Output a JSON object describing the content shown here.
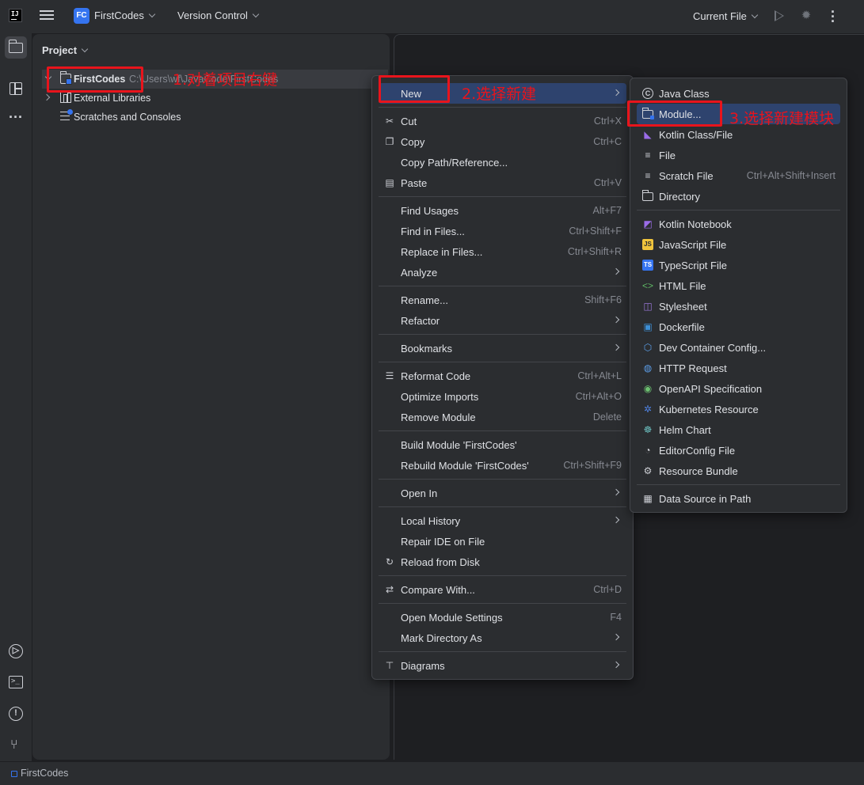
{
  "titlebar": {
    "project_badge": "FC",
    "project_name": "FirstCodes",
    "vcs_label": "Version Control",
    "run_config": "Current File"
  },
  "project_panel": {
    "title": "Project",
    "tree": [
      {
        "label": "FirstCodes",
        "path": "C:\\Users\\wf\\JavaCode\\FirstCodes",
        "icon": "module-folder-icon",
        "expanded": true
      },
      {
        "label": "External Libraries",
        "icon": "libraries-icon",
        "expanded": false
      },
      {
        "label": "Scratches and Consoles",
        "icon": "scratches-icon"
      }
    ]
  },
  "context_menu": {
    "items": [
      {
        "label": "New",
        "submenu": true,
        "highlighted": true
      },
      {
        "separator": true
      },
      {
        "label": "Cut",
        "shortcut": "Ctrl+X",
        "icon": "cut-icon"
      },
      {
        "label": "Copy",
        "shortcut": "Ctrl+C",
        "icon": "copy-icon"
      },
      {
        "label": "Copy Path/Reference..."
      },
      {
        "label": "Paste",
        "shortcut": "Ctrl+V",
        "icon": "paste-icon"
      },
      {
        "separator": true
      },
      {
        "label": "Find Usages",
        "shortcut": "Alt+F7"
      },
      {
        "label": "Find in Files...",
        "shortcut": "Ctrl+Shift+F"
      },
      {
        "label": "Replace in Files...",
        "shortcut": "Ctrl+Shift+R"
      },
      {
        "label": "Analyze",
        "submenu": true
      },
      {
        "separator": true
      },
      {
        "label": "Rename...",
        "shortcut": "Shift+F6"
      },
      {
        "label": "Refactor",
        "submenu": true
      },
      {
        "separator": true
      },
      {
        "label": "Bookmarks",
        "submenu": true
      },
      {
        "separator": true
      },
      {
        "label": "Reformat Code",
        "shortcut": "Ctrl+Alt+L",
        "icon": "reformat-icon"
      },
      {
        "label": "Optimize Imports",
        "shortcut": "Ctrl+Alt+O"
      },
      {
        "label": "Remove Module",
        "shortcut": "Delete"
      },
      {
        "separator": true
      },
      {
        "label": "Build Module 'FirstCodes'"
      },
      {
        "label": "Rebuild Module 'FirstCodes'",
        "shortcut": "Ctrl+Shift+F9"
      },
      {
        "separator": true
      },
      {
        "label": "Open In",
        "submenu": true
      },
      {
        "separator": true
      },
      {
        "label": "Local History",
        "submenu": true
      },
      {
        "label": "Repair IDE on File"
      },
      {
        "label": "Reload from Disk",
        "icon": "reload-icon"
      },
      {
        "separator": true
      },
      {
        "label": "Compare With...",
        "shortcut": "Ctrl+D",
        "icon": "compare-icon"
      },
      {
        "separator": true
      },
      {
        "label": "Open Module Settings",
        "shortcut": "F4"
      },
      {
        "label": "Mark Directory As",
        "submenu": true
      },
      {
        "separator": true
      },
      {
        "label": "Diagrams",
        "submenu": true,
        "icon": "diagrams-icon"
      }
    ]
  },
  "new_submenu": {
    "items": [
      {
        "label": "Java Class",
        "icon": "java-class-icon"
      },
      {
        "label": "Module...",
        "icon": "module-icon",
        "highlighted": true
      },
      {
        "label": "Kotlin Class/File",
        "icon": "kotlin-icon"
      },
      {
        "label": "File",
        "icon": "file-icon"
      },
      {
        "label": "Scratch File",
        "shortcut": "Ctrl+Alt+Shift+Insert",
        "icon": "scratch-file-icon"
      },
      {
        "label": "Directory",
        "icon": "directory-icon"
      },
      {
        "separator": true
      },
      {
        "label": "Kotlin Notebook",
        "icon": "notebook-icon"
      },
      {
        "label": "JavaScript File",
        "icon": "javascript-icon"
      },
      {
        "label": "TypeScript File",
        "icon": "typescript-icon"
      },
      {
        "label": "HTML File",
        "icon": "html-icon"
      },
      {
        "label": "Stylesheet",
        "icon": "stylesheet-icon"
      },
      {
        "label": "Dockerfile",
        "icon": "docker-icon"
      },
      {
        "label": "Dev Container Config...",
        "icon": "dev-container-icon"
      },
      {
        "label": "HTTP Request",
        "icon": "globe-icon"
      },
      {
        "label": "OpenAPI Specification",
        "icon": "openapi-icon"
      },
      {
        "label": "Kubernetes Resource",
        "icon": "kubernetes-icon"
      },
      {
        "label": "Helm Chart",
        "icon": "helm-icon"
      },
      {
        "label": "EditorConfig File",
        "icon": "editorconfig-icon"
      },
      {
        "label": "Resource Bundle",
        "icon": "resource-bundle-icon"
      },
      {
        "separator": true
      },
      {
        "label": "Data Source in Path",
        "icon": "database-icon"
      }
    ]
  },
  "annotations": [
    {
      "text": "1.对着项目右键"
    },
    {
      "text": "2.选择新建"
    },
    {
      "text": "3.选择新建模块"
    }
  ],
  "statusbar": {
    "label": "FirstCodes"
  },
  "colors": {
    "background": "#1e1f22",
    "panel": "#2b2d30",
    "highlight": "#2e436e",
    "accent": "#3574f0",
    "annotation": "#e8141c"
  }
}
